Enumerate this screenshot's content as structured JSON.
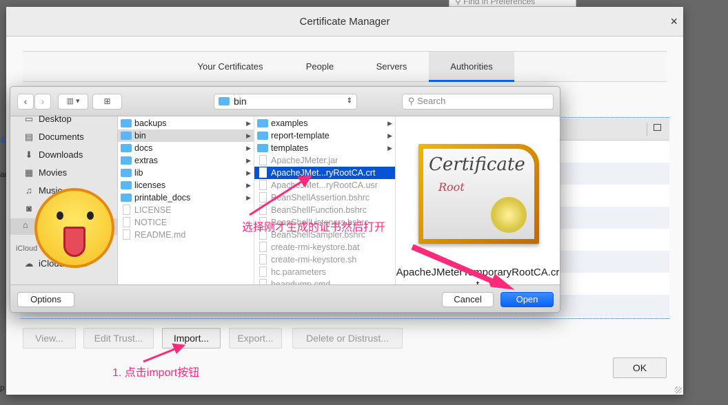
{
  "background": {
    "search_placeholder": "Find in Preferences",
    "edge_texts": [
      "&",
      "ac",
      "p"
    ]
  },
  "window": {
    "title": "Certificate Manager",
    "close": "×",
    "tabs": [
      {
        "label": "Your Certificates"
      },
      {
        "label": "People"
      },
      {
        "label": "Servers"
      },
      {
        "label": "Authorities",
        "active": true
      }
    ],
    "buttons": {
      "view": "View...",
      "edit_trust": "Edit Trust...",
      "import": "Import...",
      "export": "Export...",
      "delete": "Delete or Distrust...",
      "ok": "OK"
    }
  },
  "dialog": {
    "location": "bin",
    "search_placeholder": "Search",
    "sidebar": [
      "Desktop",
      "Documents",
      "Downloads",
      "Movies",
      "Music",
      "iCloud",
      "iCloud Drive"
    ],
    "column1": [
      {
        "name": "backups",
        "type": "folder"
      },
      {
        "name": "bin",
        "type": "folder",
        "selected": true
      },
      {
        "name": "docs",
        "type": "folder"
      },
      {
        "name": "extras",
        "type": "folder"
      },
      {
        "name": "lib",
        "type": "folder"
      },
      {
        "name": "licenses",
        "type": "folder"
      },
      {
        "name": "printable_docs",
        "type": "folder"
      },
      {
        "name": "LICENSE",
        "type": "file"
      },
      {
        "name": "NOTICE",
        "type": "file"
      },
      {
        "name": "README.md",
        "type": "file"
      }
    ],
    "column2": [
      {
        "name": "examples",
        "type": "folder"
      },
      {
        "name": "report-template",
        "type": "folder"
      },
      {
        "name": "templates",
        "type": "folder"
      },
      {
        "name": "ApacheJMeter.jar",
        "type": "file"
      },
      {
        "name": "ApacheJMet...ryRootCA.crt",
        "type": "file",
        "selected": true
      },
      {
        "name": "ApacheJMet...ryRootCA.usr",
        "type": "file"
      },
      {
        "name": "BeanShellAssertion.bshrc",
        "type": "file"
      },
      {
        "name": "BeanShellFunction.bshrc",
        "type": "file"
      },
      {
        "name": "BeanShellListeners.bshrc",
        "type": "file"
      },
      {
        "name": "BeanShellSampler.bshrc",
        "type": "file"
      },
      {
        "name": "create-rmi-keystore.bat",
        "type": "file"
      },
      {
        "name": "create-rmi-keystore.sh",
        "type": "file"
      },
      {
        "name": "hc.parameters",
        "type": "file"
      },
      {
        "name": "heapdump.cmd",
        "type": "file"
      }
    ],
    "preview": {
      "name": "ApacheJMeterTemporaryRootCA.crt",
      "icon_text": "Certificate",
      "icon_sub": "Root"
    },
    "options": "Options",
    "cancel": "Cancel",
    "open": "Open"
  },
  "annotations": {
    "step1": "1. 点击import按钮",
    "step2": "选择刚才生成的证书然后打开",
    "color": "#ff2a7a"
  }
}
